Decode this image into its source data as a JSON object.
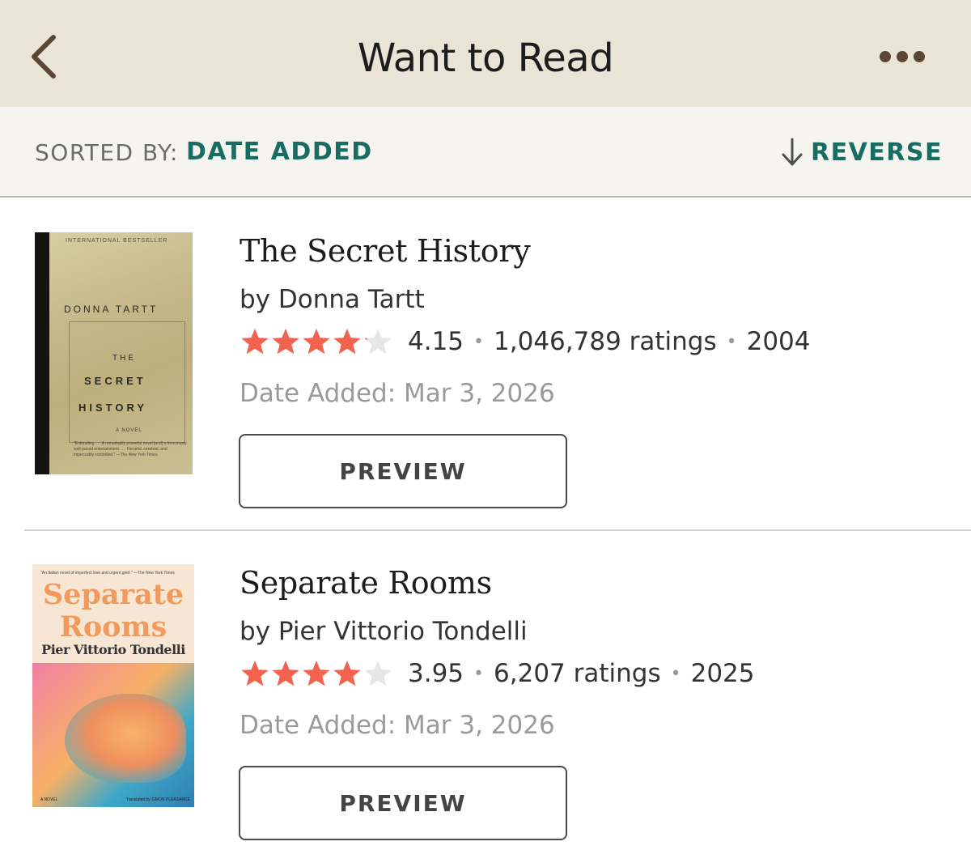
{
  "header": {
    "title": "Want to Read",
    "back_icon": "chevron-left-icon",
    "more_icon": "more-horizontal-icon"
  },
  "sortbar": {
    "label": "SORTED BY:",
    "value": "DATE ADDED",
    "reverse_label": "REVERSE",
    "reverse_icon": "arrow-down-icon"
  },
  "colors": {
    "header_bg": "#e9e4d6",
    "accent": "#176d63",
    "star": "#f2624f",
    "star_empty": "#e6e6e6"
  },
  "books": [
    {
      "title": "The Secret History",
      "author": "by Donna Tartt",
      "rating": "4.15",
      "rating_value": 4.15,
      "ratings_count": "1,046,789 ratings",
      "year": "2004",
      "date_added": "Date Added: Mar 3, 2026",
      "preview_label": "PREVIEW",
      "cover": {
        "tagline": "INTERNATIONAL BESTSELLER",
        "author": "DONNA TARTT",
        "title_line1": "THE",
        "title_line2": "SECRET",
        "title_line3": "HISTORY",
        "subtitle": "A NOVEL",
        "quote": "\"Enthralling . . . A remarkably powerful novel [and] a ferociously well-paced entertainment . . . Forceful, cerebral, and impeccably controlled.\" —The New York Times"
      }
    },
    {
      "title": "Separate Rooms",
      "author": "by Pier Vittorio Tondelli",
      "rating": "3.95",
      "rating_value": 3.95,
      "ratings_count": "6,207 ratings",
      "year": "2025",
      "date_added": "Date Added: Mar 3, 2026",
      "preview_label": "PREVIEW",
      "cover": {
        "quote": "\"An Italian novel of imperfect love and urgent grief.\" —The New York Times",
        "title_line1": "Separate",
        "title_line2": "Rooms",
        "author": "Pier Vittorio Tondelli",
        "footer_left": "A NOVEL",
        "footer_right": "Translated by SIMON PLEASANCE"
      }
    }
  ]
}
